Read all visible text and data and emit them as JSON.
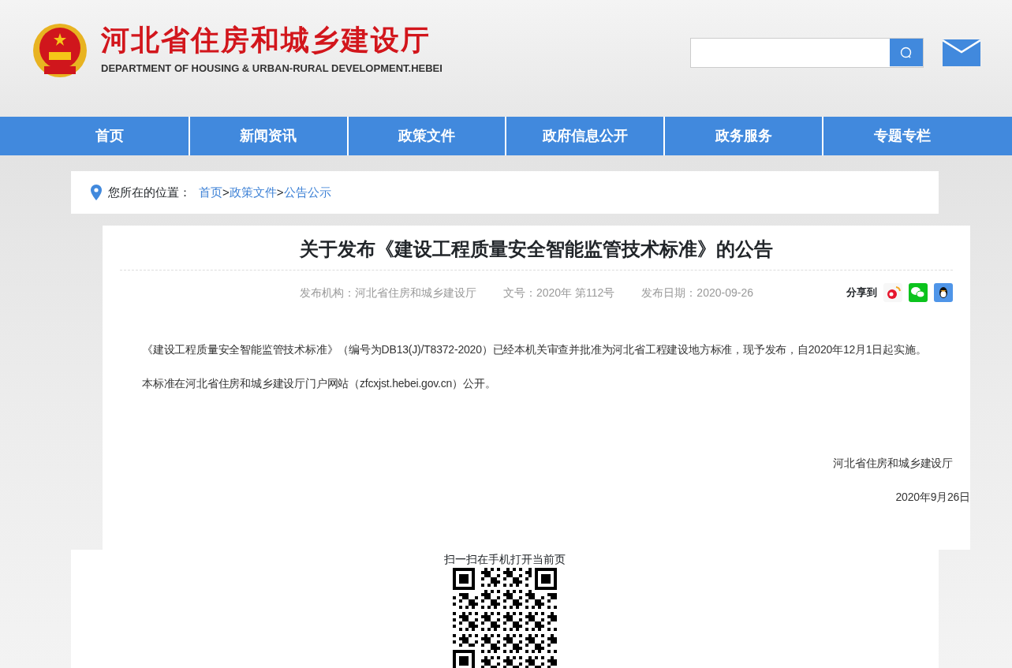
{
  "header": {
    "title": "河北省住房和城乡建设厅",
    "subtitle": "DEPARTMENT OF HOUSING & URBAN-RURAL DEVELOPMENT.HEBEI"
  },
  "nav": [
    {
      "label": "首页"
    },
    {
      "label": "新闻资讯"
    },
    {
      "label": "政策文件"
    },
    {
      "label": "政府信息公开"
    },
    {
      "label": "政务服务"
    },
    {
      "label": "专题专栏"
    }
  ],
  "breadcrumb": {
    "label": "您所在的位置：",
    "items": [
      "首页",
      "政策文件",
      "公告公示"
    ],
    "separator": ">"
  },
  "article": {
    "title": "关于发布《建设工程质量安全智能监管技术标准》的公告",
    "meta": [
      "发布机构：河北省住房和城乡建设厅",
      "文号：2020年 第112号",
      "发布日期：2020-09-26"
    ],
    "share_label": "分享到",
    "paragraphs": [
      "《建设工程质量安全智能监管技术标准》（编号为DB13(J)/T8372-2020）已经本机关审查并批准为河北省工程建设地方标准，现予发布，自2020年12月1日起实施。",
      "本标准在河北省住房和城乡建设厅门户网站（zfcxjst.hebei.gov.cn）公开。"
    ],
    "signature": "河北省住房和城乡建设厅",
    "date": "2020年9月26日"
  },
  "qr": {
    "caption": "扫一扫在手机打开当前页"
  }
}
